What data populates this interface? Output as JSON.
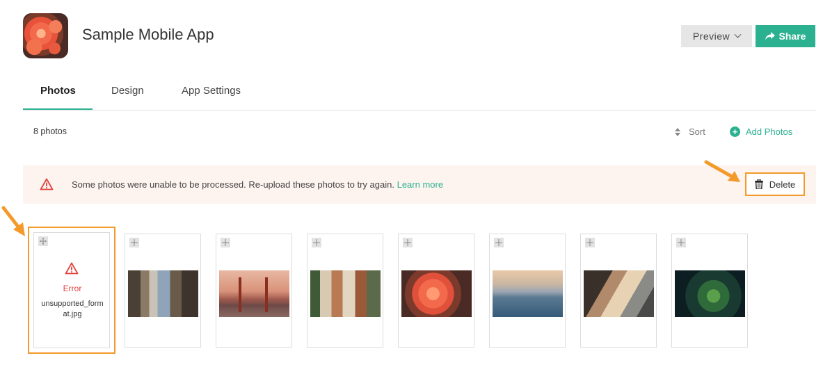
{
  "app": {
    "title": "Sample Mobile App",
    "icon": "flower-photo-icon"
  },
  "header": {
    "preview_label": "Preview",
    "share_label": "Share"
  },
  "tabs": [
    {
      "label": "Photos",
      "active": true
    },
    {
      "label": "Design",
      "active": false
    },
    {
      "label": "App Settings",
      "active": false
    }
  ],
  "toolbar": {
    "photo_count": "8 photos",
    "sort_label": "Sort",
    "add_photos_label": "Add Photos"
  },
  "alert": {
    "message": "Some photos were unable to be processed. Re-upload these photos to try again.",
    "link": "Learn more",
    "delete_label": "Delete"
  },
  "photos": [
    {
      "status": "error",
      "error_label": "Error",
      "filename": "unsupported_format.jpg"
    },
    {
      "status": "ok",
      "thumbnail": "city-street"
    },
    {
      "status": "ok",
      "thumbnail": "golden-gate-bridge"
    },
    {
      "status": "ok",
      "thumbnail": "village-buildings"
    },
    {
      "status": "ok",
      "thumbnail": "orange-flowers"
    },
    {
      "status": "ok",
      "thumbnail": "sea-horizon"
    },
    {
      "status": "ok",
      "thumbnail": "mountain-cliff"
    },
    {
      "status": "ok",
      "thumbnail": "green-leaves"
    }
  ],
  "colors": {
    "accent": "#2bb190",
    "error": "#e0433c",
    "highlight": "#f39a2a",
    "alert_bg": "#fdf3ef"
  }
}
